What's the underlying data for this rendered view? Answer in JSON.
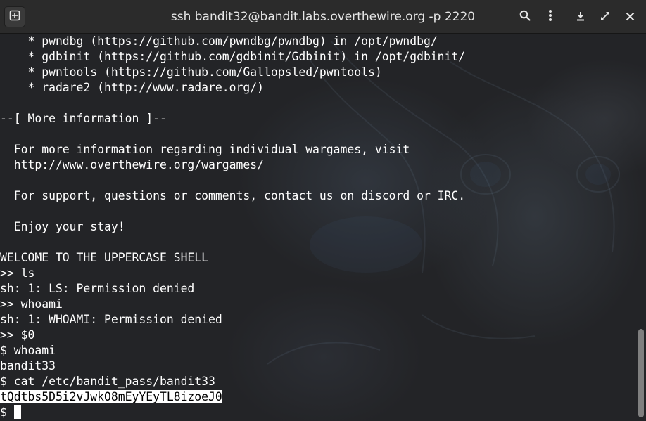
{
  "window": {
    "title": "ssh bandit32@bandit.labs.overthewire.org -p 2220"
  },
  "header": {
    "icons": [
      "new-tab-icon",
      "search-icon",
      "menu-icon",
      "download-icon",
      "maximize-icon",
      "close-icon"
    ]
  },
  "terminal": {
    "lines": [
      "    * pwndbg (https://github.com/pwndbg/pwndbg) in /opt/pwndbg/",
      "    * gdbinit (https://github.com/gdbinit/Gdbinit) in /opt/gdbinit/",
      "    * pwntools (https://github.com/Gallopsled/pwntools)",
      "    * radare2 (http://www.radare.org/)",
      "",
      "--[ More information ]--",
      "",
      "  For more information regarding individual wargames, visit",
      "  http://www.overthewire.org/wargames/",
      "",
      "  For support, questions or comments, contact us on discord or IRC.",
      "",
      "  Enjoy your stay!",
      "",
      "WELCOME TO THE UPPERCASE SHELL",
      ">> ls",
      "sh: 1: LS: Permission denied",
      ">> whoami",
      "sh: 1: WHOAMI: Permission denied",
      ">> $0",
      "$ whoami",
      "bandit33",
      "$ cat /etc/bandit_pass/bandit33"
    ],
    "selected_output": "tQdtbs5D5i2vJwkO8mEyYEyTL8izoeJ0",
    "prompt": "$"
  },
  "colors": {
    "titlebar": "#2b2b2b",
    "terminal_bg": "#232427",
    "text": "#ffffff",
    "selection_bg": "#ffffff",
    "selection_fg": "#000000"
  }
}
